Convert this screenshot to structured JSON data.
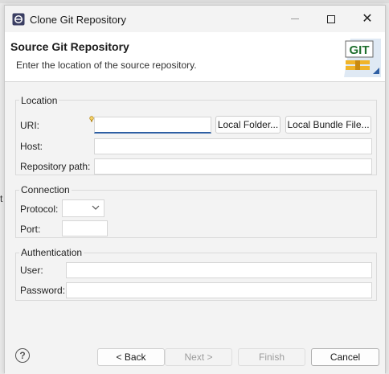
{
  "window": {
    "title": "Clone Git Repository"
  },
  "header": {
    "title": "Source Git Repository",
    "description": "Enter the location of the source repository.",
    "logo_text": "GIT"
  },
  "location": {
    "group_label": "Location",
    "uri_label": "URI:",
    "uri_value": "",
    "local_folder_button": "Local Folder...",
    "local_bundle_button": "Local Bundle File...",
    "host_label": "Host:",
    "host_value": "",
    "repo_path_label": "Repository path:",
    "repo_path_value": ""
  },
  "connection": {
    "group_label": "Connection",
    "protocol_label": "Protocol:",
    "protocol_value": "",
    "port_label": "Port:",
    "port_value": ""
  },
  "authentication": {
    "group_label": "Authentication",
    "user_label": "User:",
    "user_value": "",
    "password_label": "Password:",
    "password_value": ""
  },
  "footer": {
    "back_button": "< Back",
    "next_button": "Next >",
    "finish_button": "Finish",
    "cancel_button": "Cancel"
  },
  "colors": {
    "focus_underline": "#2e5fa3",
    "window_bg": "#f3f3f3",
    "header_bg": "#ffffff"
  }
}
